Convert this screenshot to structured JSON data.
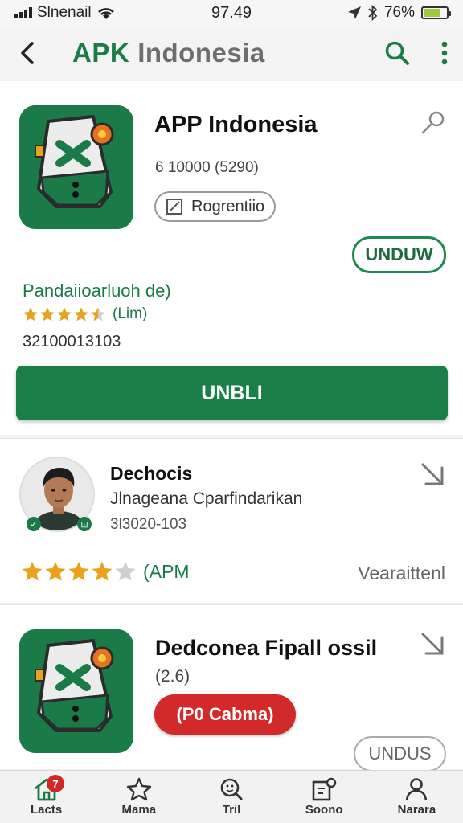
{
  "status_bar": {
    "carrier": "Slnenail",
    "time": "97.49",
    "battery_percent": "76%",
    "battery_level": 0.76
  },
  "app_bar": {
    "title_brand": "APK",
    "title_rest": "Indonesia"
  },
  "featured": {
    "name": "APP Indonesia",
    "meta": "6 10000 (5290)",
    "tag": "Rogrentiio",
    "outline_button": "UNDUW",
    "developer": "Pandaiioarluoh de)",
    "rating_value": 4.5,
    "rating_label": "(Lim)",
    "count": "32100013103",
    "primary_button": "UNBLI"
  },
  "review": {
    "title": "Dechocis",
    "subtitle": "Jlnageana Cparfindarikan",
    "meta": "3l3020-103",
    "rating_value": 4,
    "rating_label": "(APM",
    "version": "Vearaittenl"
  },
  "second_app": {
    "name": "Dedconea  Fipall ossil",
    "meta": "(2.6)",
    "red_pill": "(P0 Cabma)",
    "button": "UNDUS"
  },
  "bottom_nav": {
    "items": [
      {
        "label": "Lacts",
        "icon": "home-icon",
        "badge": "7"
      },
      {
        "label": "Mama",
        "icon": "star-outline-icon"
      },
      {
        "label": "Tril",
        "icon": "search-face-icon"
      },
      {
        "label": "Soono",
        "icon": "notes-icon"
      },
      {
        "label": "Narara",
        "icon": "person-icon"
      }
    ]
  },
  "colors": {
    "brand_green": "#1a8048",
    "star_gold": "#e8a21c",
    "red": "#d22a2a"
  }
}
